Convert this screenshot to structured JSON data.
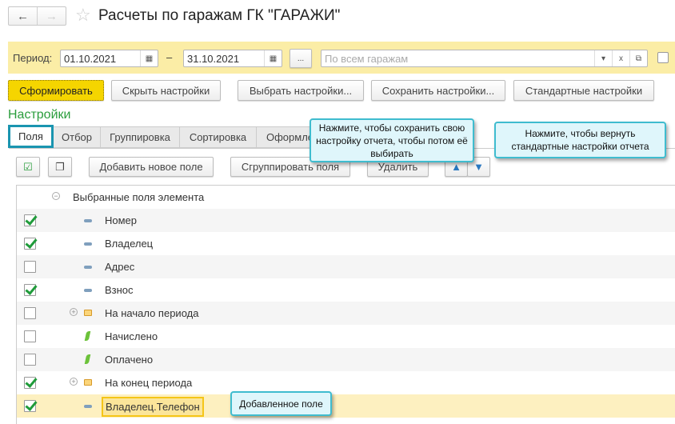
{
  "header": {
    "title": "Расчеты по гаражам ГК \"ГАРАЖИ\"",
    "back": "←",
    "forward": "→",
    "star": "☆"
  },
  "filter": {
    "period_label": "Период:",
    "date_from": "01.10.2021",
    "date_sep": "–",
    "date_to": "31.10.2021",
    "ellipsis": "...",
    "garage_placeholder": "По всем гаражам",
    "clear": "x"
  },
  "toolbar": {
    "generate": "Сформировать",
    "hide": "Скрыть настройки",
    "choose": "Выбрать настройки...",
    "save": "Сохранить настройки...",
    "standard": "Стандартные настройки"
  },
  "settings_title": "Настройки",
  "tabs": [
    {
      "label": "Поля"
    },
    {
      "label": "Отбор"
    },
    {
      "label": "Группировка"
    },
    {
      "label": "Сортировка"
    },
    {
      "label": "Оформле"
    }
  ],
  "fields_toolbar": {
    "add": "Добавить новое поле",
    "group": "Сгруппировать поля",
    "delete": "Удалить"
  },
  "tree": {
    "root": "Выбранные поля элемента",
    "rows": [
      {
        "label": "Номер",
        "checked": true,
        "icon": "field"
      },
      {
        "label": "Владелец",
        "checked": true,
        "icon": "field"
      },
      {
        "label": "Адрес",
        "checked": false,
        "icon": "field"
      },
      {
        "label": "Взнос",
        "checked": true,
        "icon": "field"
      },
      {
        "label": "На начало периода",
        "checked": false,
        "icon": "folder"
      },
      {
        "label": "Начислено",
        "checked": false,
        "icon": "resource"
      },
      {
        "label": "Оплачено",
        "checked": false,
        "icon": "resource"
      },
      {
        "label": "На конец периода",
        "checked": true,
        "icon": "folder"
      },
      {
        "label": "Владелец.Телефон",
        "checked": true,
        "icon": "field"
      }
    ]
  },
  "callouts": {
    "save": "Нажмите, чтобы сохранить свою настройку отчета, чтобы потом её выбирать",
    "standard": "Нажмите, чтобы вернуть стандартные настройки отчета",
    "added": "Добавленное поле"
  },
  "colors": {
    "accent": "#1a95b0",
    "band": "#fbeda6",
    "generate": "#f5d500",
    "green_title": "#2a9d3c"
  }
}
